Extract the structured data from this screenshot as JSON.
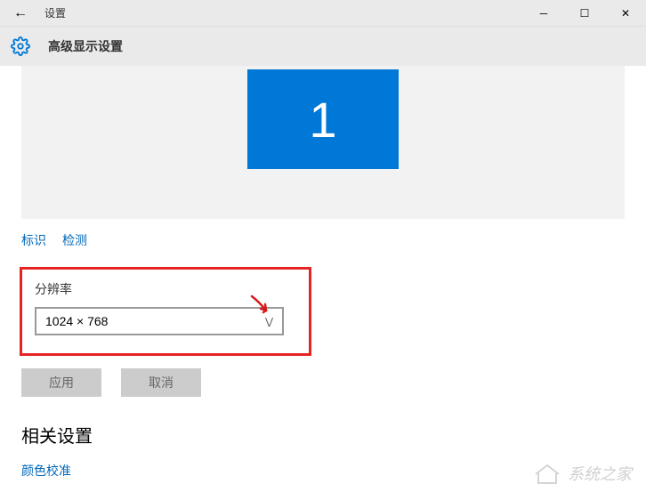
{
  "window": {
    "title": "设置"
  },
  "header": {
    "page_title": "高级显示设置"
  },
  "monitor": {
    "number": "1"
  },
  "links": {
    "identify": "标识",
    "detect": "检测"
  },
  "resolution": {
    "label": "分辨率",
    "value": "1024 × 768"
  },
  "buttons": {
    "apply": "应用",
    "cancel": "取消"
  },
  "related": {
    "heading": "相关设置",
    "color_calibration": "颜色校准"
  },
  "watermark": {
    "text": "系统之家"
  }
}
